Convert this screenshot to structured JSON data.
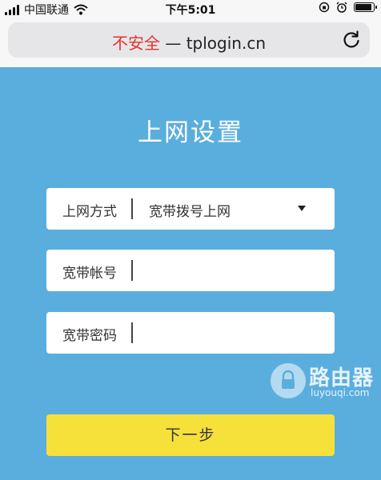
{
  "status_bar": {
    "carrier": "中国联通",
    "time": "下午5:01"
  },
  "address_bar": {
    "security_label": "不安全",
    "separator": "—",
    "domain": "tplogin.cn"
  },
  "page": {
    "title": "上网设置"
  },
  "form": {
    "connection_type": {
      "label": "上网方式",
      "value": "宽带拨号上网"
    },
    "account": {
      "label": "宽带帐号",
      "value": ""
    },
    "password": {
      "label": "宽带密码",
      "value": ""
    },
    "next_label": "下一步"
  },
  "watermark": {
    "name": "路由器",
    "url": "luyouqi.com"
  },
  "colors": {
    "background": "#5aaede",
    "button": "#f6e03a",
    "insecure": "#e2342e"
  }
}
